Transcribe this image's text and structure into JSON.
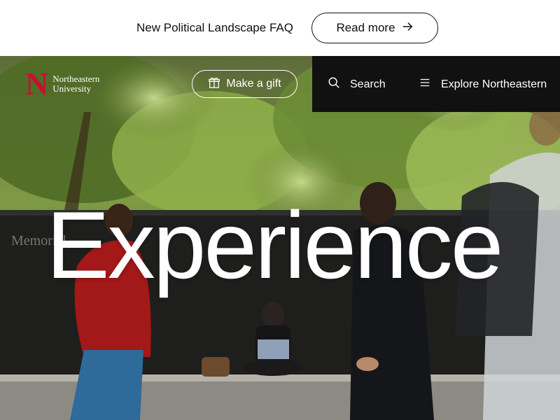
{
  "banner": {
    "text": "New Political Landscape FAQ",
    "button_label": "Read more"
  },
  "header": {
    "logo_line1": "Northeastern",
    "logo_line2": "University",
    "logo_mark": "N",
    "gift_label": "Make a gift",
    "search_label": "Search",
    "explore_label": "Explore Northeastern"
  },
  "hero": {
    "headline": "Experience",
    "wall_text": "Memorial"
  },
  "icons": {
    "arrow": "arrow-right-icon",
    "gift": "gift-icon",
    "search": "search-icon",
    "menu": "menu-icon"
  },
  "colors": {
    "brand_red": "#c8102e",
    "nav_bg": "#111111"
  }
}
